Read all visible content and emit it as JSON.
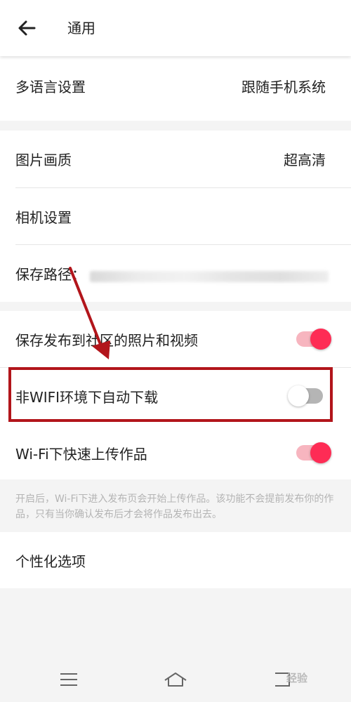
{
  "header": {
    "title": "通用"
  },
  "language": {
    "label": "多语言设置",
    "value": "跟随手机系统"
  },
  "media": {
    "quality_label": "图片画质",
    "quality_value": "超高清",
    "camera_label": "相机设置",
    "path_label": "保存路径："
  },
  "toggles": {
    "save_posts": {
      "label": "保存发布到社区的照片和视频",
      "on": true
    },
    "auto_download": {
      "label": "非WIFI环境下自动下载",
      "on": false
    },
    "wifi_upload": {
      "label": "Wi-Fi下快速上传作品",
      "on": true
    }
  },
  "hint": "开启后，Wi-Fi下进入发布页会开始上传作品。该功能不会提前发布你的作品，只有当你确认发布后才会将作品发布出去。",
  "personalize": {
    "label": "个性化选项"
  },
  "watermark": "经验",
  "colors": {
    "accent": "#fe2c55",
    "annotation": "#b2151b"
  }
}
